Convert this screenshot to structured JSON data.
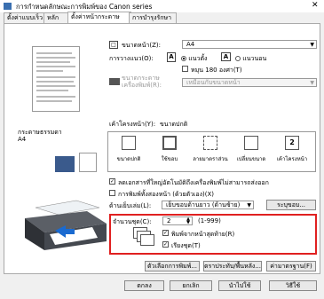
{
  "window": {
    "title": "การกำหนดลักษณะการพิมพ์ของ Canon           series",
    "close_glyph": "✕"
  },
  "tabs": [
    "ตั้งค่าแบบเร็ว",
    "หลัก",
    "ตั้งค่าหน้ากระดาษ",
    "การบำรุงรักษา"
  ],
  "left": {
    "paper_label": "กระดาษธรรมดา",
    "paper_size": "A4"
  },
  "page_size": {
    "label": "ขนาดหน้า(Z):",
    "value": "A4"
  },
  "orientation": {
    "label": "การวางแนว(O):",
    "portrait": "แนวตั้ง",
    "landscape": "แนวนอน",
    "rotate_label": "หมุน 180 องศา(T)"
  },
  "printer_paper_size": {
    "label": "ขนาดกระดาษเครื่องพิมพ์(R):",
    "value": "เหมือนกับขนาดหน้า"
  },
  "page_layout": {
    "label": "เค้าโครงหน้า(Y):",
    "current": "ขนาดปกติ",
    "items": [
      "ขนาดปกติ",
      "ใช้ขอบ",
      "ลายมาตราส่วน",
      "เปลี่ยนขนาด",
      "เค้าโครงหน้า"
    ],
    "item5_number": "2"
  },
  "auto_reduce": {
    "label": "ลดเอกสารที่ใหญ่อัตโนมัติถึงเครื่องพิมพ์ไม่สามารถส่งออก"
  },
  "duplex": {
    "label": "การพิมพ์ทั้งสองหน้า (ด้วยตัวเอง)(X)"
  },
  "stapling": {
    "label": "ด้านเย็บเล่ม(L):",
    "value": "เย็บขอบด้านยาว (ด้านซ้าย)",
    "button": "ระบุขอบ..."
  },
  "copies": {
    "label": "จำนวนชุด(C):",
    "value": "2",
    "range": "(1-999)",
    "reverse_label": "พิมพ์จากหน้าสุดท้าย(R)",
    "collate_label": "เรียงชุด(T)"
  },
  "bottom_buttons": {
    "print_options": "ตัวเลือกการพิมพ์...",
    "stamp": "ตราประทับ/พื้นหลัง...",
    "defaults": "ค่ามาตรฐาน(F)"
  },
  "footer": {
    "ok": "ตกลง",
    "cancel": "ยกเลิก",
    "apply": "นำไปใช้",
    "help": "วิธีใช้"
  }
}
